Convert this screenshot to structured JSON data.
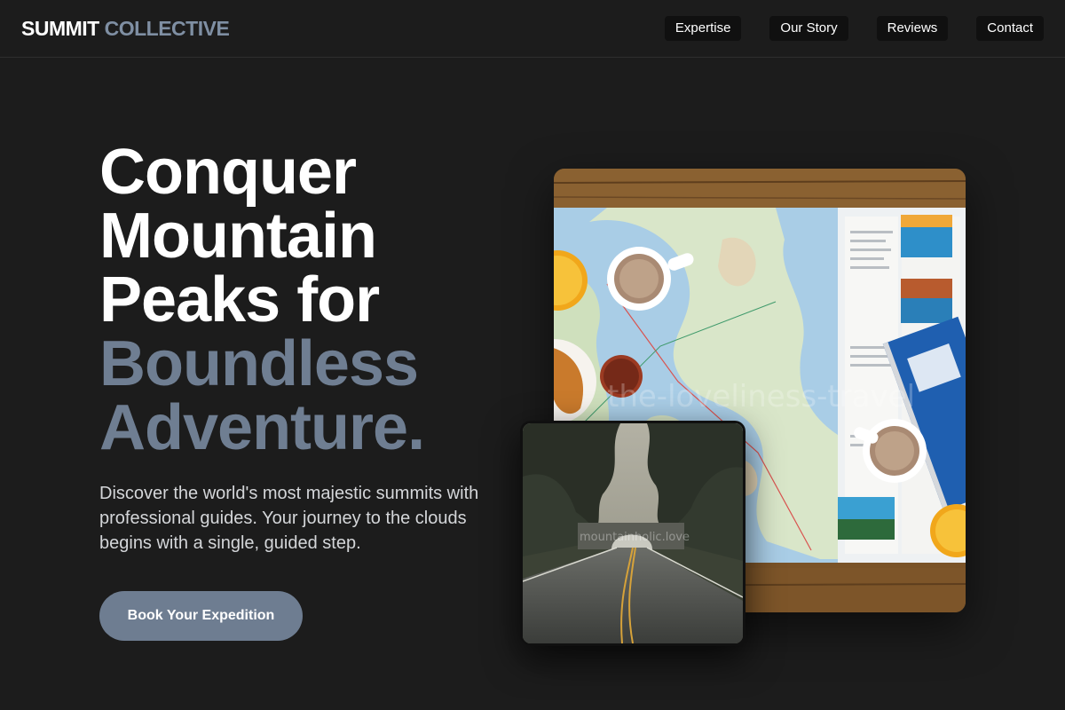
{
  "header": {
    "logo_primary": "SUMMIT",
    "logo_secondary": "COLLECTIVE",
    "nav": [
      {
        "label": "Expertise"
      },
      {
        "label": "Our Story"
      },
      {
        "label": "Reviews"
      },
      {
        "label": "Contact"
      }
    ]
  },
  "hero": {
    "title_lines": [
      "Conquer",
      "Mountain",
      "Peaks for"
    ],
    "title_accent_lines": [
      "Boundless",
      "Adventure."
    ],
    "subtitle": "Discover the world's most majestic summits with professional guides. Your journey to the clouds begins with a single, guided step.",
    "cta_label": "Book Your Expedition"
  },
  "images": {
    "main_watermark": "the-loveliness-travel",
    "secondary_watermark": "mountainholic.love"
  },
  "colors": {
    "background": "#1c1c1c",
    "accent": "#6f7e92",
    "nav_bg": "#101010"
  }
}
